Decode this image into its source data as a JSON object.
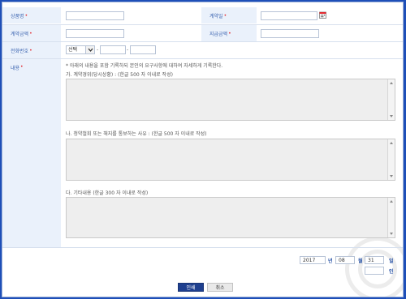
{
  "form": {
    "product_name_label": "상품명",
    "contract_date_label": "계약일",
    "contract_amount_label": "계약금액",
    "paid_amount_label": "지급금액",
    "phone_label": "전화번호",
    "content_label": "내용",
    "required_mark": "•",
    "phone_select_value": "선택",
    "phone_sep1": "-",
    "phone_sep2": "-"
  },
  "content": {
    "intro": "* 아래의 내용을 포함 기록하되 본인의 요구사항에 대하여 자세하게 기록한다.",
    "section_a": "가. 계약경위(당시상황) : (한글 500 자 이내로 작성)",
    "section_b": "나. 청약철회 또는 해지를 통보하는 사유 : (한글 500 자 이내로 작성)",
    "section_c": "다. 기타내용 (한글 300 자 이내로 작성)"
  },
  "date_footer": {
    "year": "2017",
    "year_label": "년",
    "month": "08",
    "month_label": "월",
    "day": "31",
    "day_label": "일",
    "seal_label": "인"
  },
  "actions": {
    "print_label": "인쇄",
    "cancel_label": "취소"
  },
  "icons": {
    "calendar": "calendar-icon"
  },
  "colors": {
    "frame_blue": "#1e4fb8",
    "label_bg": "#eaf1fb",
    "required_red": "#e2272c",
    "print_button": "#1e3f8f"
  }
}
